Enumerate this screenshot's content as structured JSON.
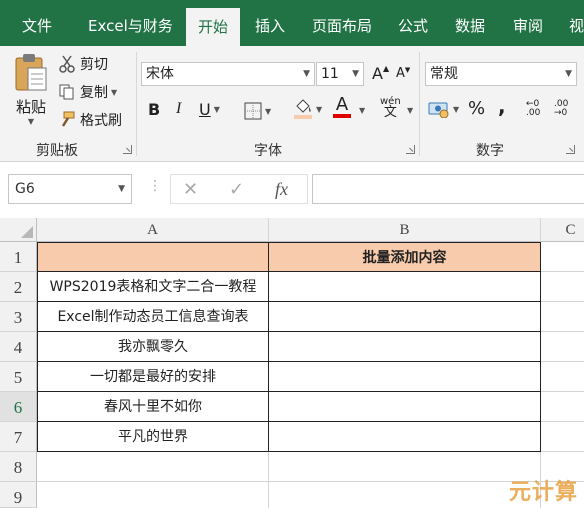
{
  "tabs": [
    "文件",
    "Excel与财务",
    "开始",
    "插入",
    "页面布局",
    "公式",
    "数据",
    "审阅",
    "视"
  ],
  "active_tab": "开始",
  "clipboard": {
    "paste_label": "粘贴",
    "cut_label": "剪切",
    "copy_label": "复制",
    "format_painter_label": "格式刷",
    "group_label": "剪贴板"
  },
  "font": {
    "name": "宋体",
    "size": "11",
    "grow_label": "A",
    "shrink_label": "A",
    "bold_label": "B",
    "italic_label": "I",
    "underline_label": "U",
    "font_color_label": "A",
    "phonetic_label": "wén",
    "phonetic_sub": "文",
    "group_label": "字体"
  },
  "number": {
    "format": "常规",
    "percent_label": "%",
    "comma_label": ",",
    "inc_decimal_label": "←0 .00",
    "dec_decimal_label": ".00 →0",
    "group_label": "数字"
  },
  "formula_bar": {
    "name_box": "G6",
    "cancel_label": "✕",
    "enter_label": "✓",
    "fx_label": "fx",
    "formula": ""
  },
  "columns": [
    "A",
    "B",
    "C"
  ],
  "rows": [
    "1",
    "2",
    "3",
    "4",
    "5",
    "6",
    "7",
    "8",
    "9"
  ],
  "selected_row": "6",
  "cells": {
    "b1": "批量添加内容",
    "a2": "WPS2019表格和文字二合一教程",
    "a3": "Excel制作动态员工信息查询表",
    "a4": "我亦飘零久",
    "a5": "一切都是最好的安排",
    "a6": "春风十里不如你",
    "a7": "平凡的世界"
  },
  "watermark": "元计算",
  "colors": {
    "ribbon_green": "#217346",
    "header_fill": "#f8cbad",
    "font_color_bar": "#e00000",
    "fill_color_bar": "#f8cbad"
  }
}
